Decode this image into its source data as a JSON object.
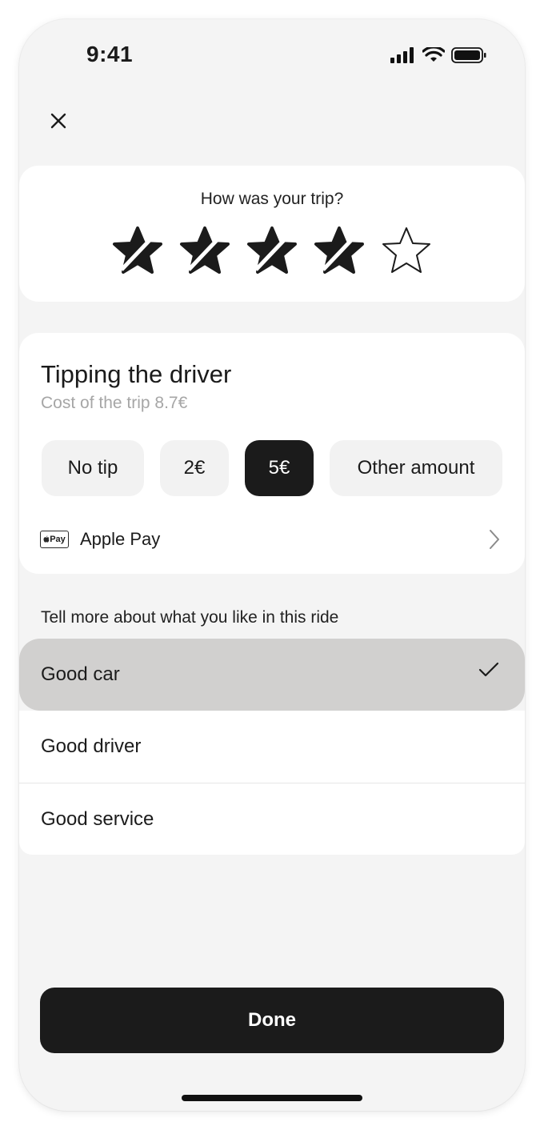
{
  "status_bar": {
    "time": "9:41"
  },
  "rating": {
    "question": "How was your trip?",
    "stars": [
      {
        "state": "filled",
        "icon": "star-filled-icon"
      },
      {
        "state": "filled",
        "icon": "star-filled-icon"
      },
      {
        "state": "filled",
        "icon": "star-filled-icon"
      },
      {
        "state": "filled",
        "icon": "star-filled-icon"
      },
      {
        "state": "empty",
        "icon": "star-outline-icon"
      }
    ],
    "value": 4,
    "max": 5
  },
  "tipping": {
    "title": "Tipping the driver",
    "subtitle": "Cost of the trip 8.7€",
    "options": [
      {
        "label": "No tip",
        "selected": false
      },
      {
        "label": "2€",
        "selected": false
      },
      {
        "label": "5€",
        "selected": true
      },
      {
        "label": "Other amount",
        "selected": false
      }
    ],
    "payment": {
      "badge": "Pay",
      "label": "Apple Pay"
    }
  },
  "feedback": {
    "prompt": "Tell more about what you like in this ride",
    "options": [
      {
        "label": "Good car",
        "selected": true
      },
      {
        "label": "Good driver",
        "selected": false
      },
      {
        "label": "Good service",
        "selected": false
      }
    ]
  },
  "done_label": "Done",
  "colors": {
    "background": "#f4f4f4",
    "card": "#ffffff",
    "primary": "#1b1b1b",
    "selected_row": "#d1d0cf",
    "muted_text": "#a6a6a6"
  }
}
